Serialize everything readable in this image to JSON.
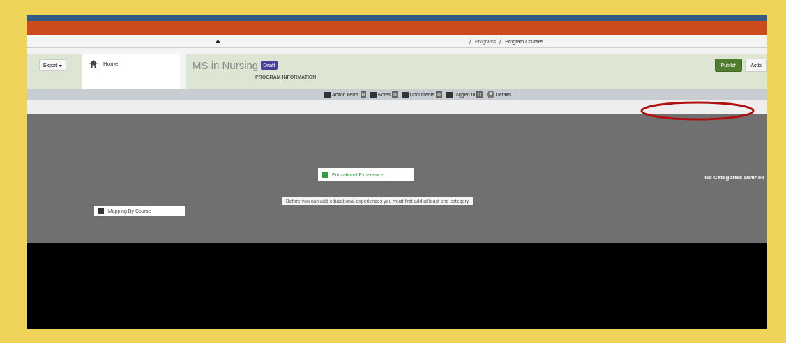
{
  "breadcrumbs": [
    "Programs",
    "Program Courses"
  ],
  "toolbar": {
    "buttons": [
      "Export"
    ]
  },
  "nav": {
    "items": [
      {
        "label": "Home"
      }
    ]
  },
  "program": {
    "title": "MS in Nursing",
    "status": "Draft",
    "section": "PROGRAM INFORMATION",
    "buttons": [
      {
        "label": "Publish",
        "kind": "primary"
      },
      {
        "label": "Actio",
        "kind": "default"
      }
    ]
  },
  "tabs": [
    {
      "label": "Action Items",
      "count": "0"
    },
    {
      "label": "Notes",
      "count": "0"
    },
    {
      "label": "Documents",
      "count": "0"
    },
    {
      "label": "Tagged In",
      "count": "0"
    },
    {
      "label": "Details"
    }
  ],
  "modal": {
    "menu_items": [
      {
        "label": "Educational Experience"
      },
      {
        "label": "Mapping By Course"
      }
    ],
    "empty_state": "No Categories Defined",
    "notice": "Before you can add educational experiences you must first add at least one category"
  }
}
